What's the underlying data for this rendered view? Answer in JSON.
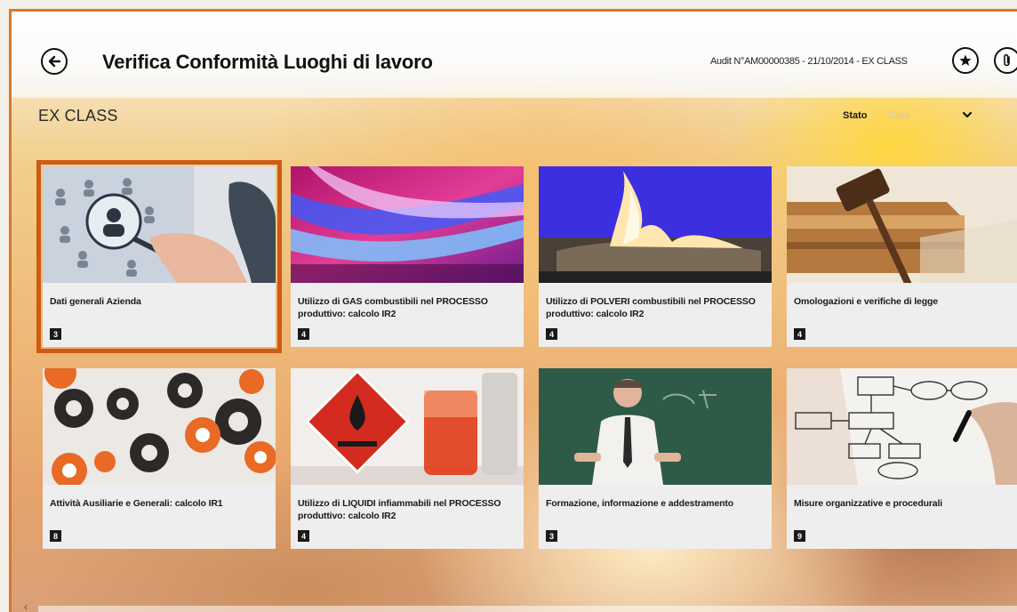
{
  "header": {
    "title": "Verifica Conformità Luoghi di lavoro",
    "audit_info": "Audit N°AM00000385 - 21/10/2014 - EX CLASS",
    "back_icon": "back-arrow-icon",
    "favorite_icon": "star-icon",
    "attach_icon": "paperclip-icon"
  },
  "section": {
    "title": "EX CLASS"
  },
  "filter": {
    "label": "Stato",
    "value": "Stato",
    "chevron_icon": "chevron-down-icon"
  },
  "colors": {
    "accent": "#cf5a14",
    "frame": "#d9782a",
    "badge": "#1a1a1a"
  },
  "tiles": [
    {
      "title": "Dati generali Azienda",
      "count": "3",
      "image": "network-people-magnifier",
      "selected": true
    },
    {
      "title": "Utilizzo di GAS combustibili nel PROCESSO produttivo: calcolo IR2",
      "count": "4",
      "image": "gas-flame"
    },
    {
      "title": "Utilizzo di POLVERI combustibili nel PROCESSO produttivo: calcolo IR2",
      "count": "4",
      "image": "dust-fire"
    },
    {
      "title": "Omologazioni e verifiche di legge",
      "count": "4",
      "image": "judge-gavel"
    },
    {
      "title": "Attività Ausiliarie e Generali: calcolo IR1",
      "count": "8",
      "image": "gears"
    },
    {
      "title": "Utilizzo di LIQUIDI infiammabili nel PROCESSO produttivo: calcolo IR2",
      "count": "4",
      "image": "flammable-liquid"
    },
    {
      "title": "Formazione, informazione e addestramento",
      "count": "3",
      "image": "teacher-blackboard"
    },
    {
      "title": "Misure organizzative e procedurali",
      "count": "9",
      "image": "flowchart"
    }
  ]
}
